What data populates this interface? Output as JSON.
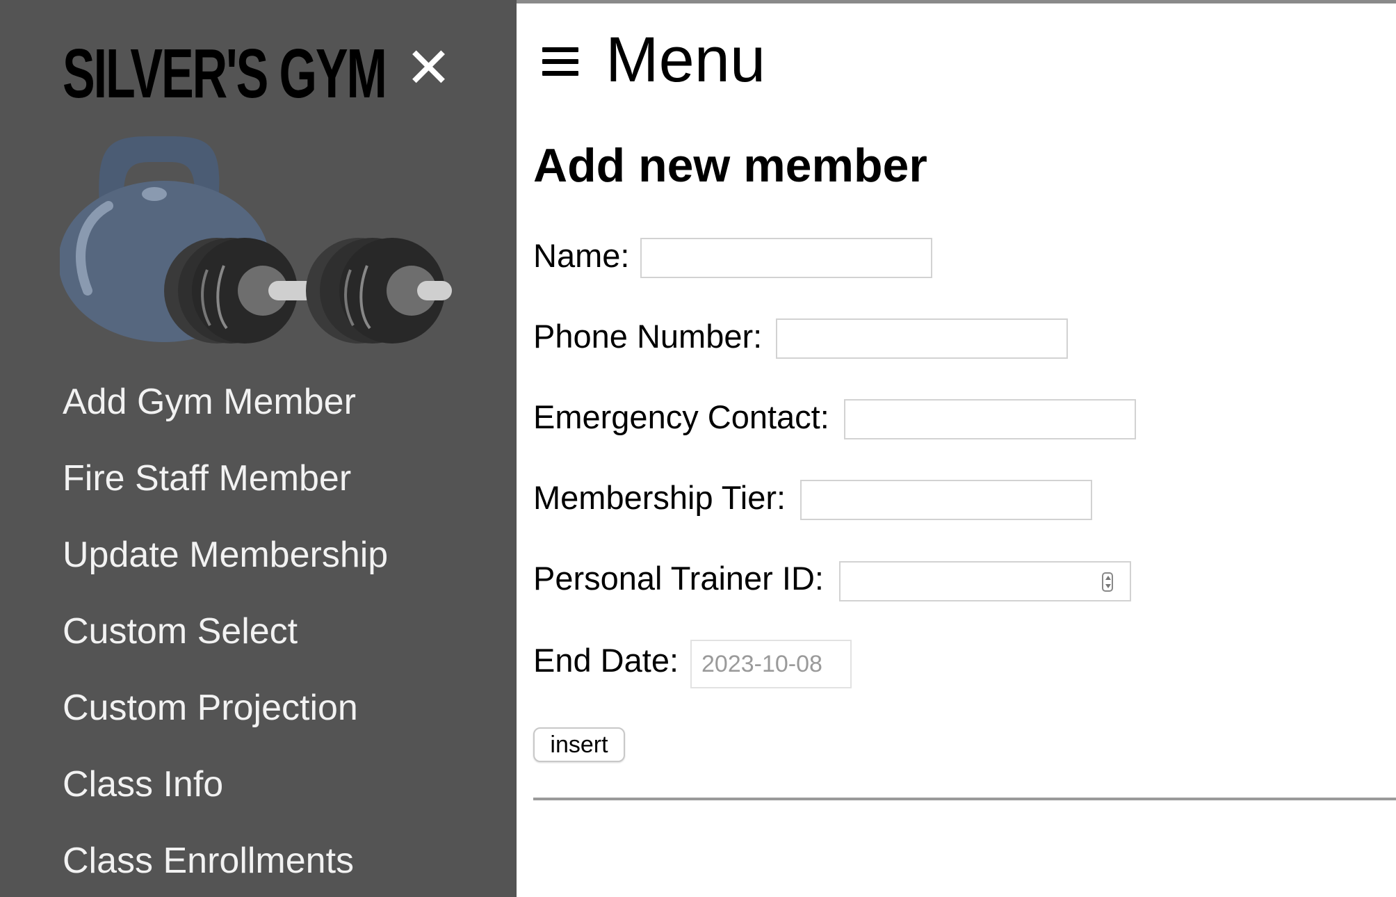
{
  "sidebar": {
    "brand": "SILVER'S GYM",
    "close_glyph": "✕",
    "illustration": "kettlebell-and-dumbbell",
    "items": [
      {
        "label": "Add Gym Member"
      },
      {
        "label": "Fire Staff Member"
      },
      {
        "label": "Update Membership"
      },
      {
        "label": "Custom Select"
      },
      {
        "label": "Custom Projection"
      },
      {
        "label": "Class Info"
      },
      {
        "label": "Class Enrollments"
      }
    ]
  },
  "header": {
    "menu_icon": "hamburger-icon",
    "menu_label": "Menu"
  },
  "form": {
    "title": "Add new member",
    "fields": [
      {
        "label": "Name:",
        "value": ""
      },
      {
        "label": "Phone Number:",
        "value": ""
      },
      {
        "label": "Emergency Contact:",
        "value": ""
      },
      {
        "label": "Membership Tier:",
        "value": ""
      },
      {
        "label": "Personal Trainer ID:",
        "value": ""
      },
      {
        "label": "End Date:",
        "value": "2023-10-08"
      }
    ],
    "submit_label": "insert"
  },
  "colors": {
    "sidebar_bg": "#545454",
    "nav_text": "#f2f2f2",
    "kettlebell": "#56677f",
    "dumbbell": "#2b2b2b"
  }
}
